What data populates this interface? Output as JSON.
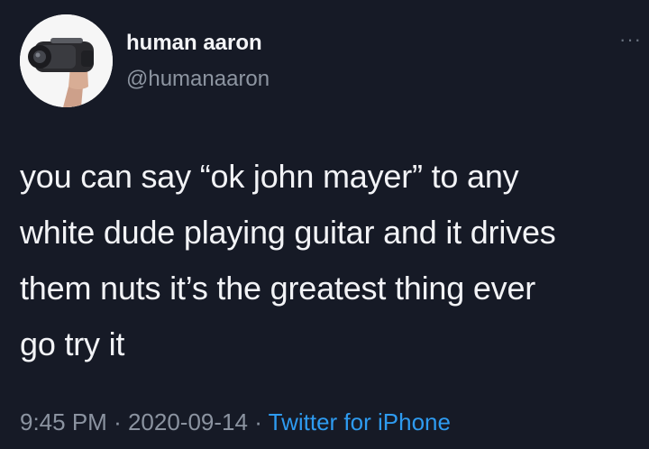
{
  "tweet": {
    "display_name": "human aaron",
    "handle": "@humanaaron",
    "more_icon": "more-horizontal-icon",
    "text_lines": [
      "you can say “ok john mayer” to any",
      "white dude playing guitar and it drives",
      "them nuts it’s the greatest thing ever",
      "go try it"
    ],
    "time": "9:45 PM",
    "date": "2020-09-14",
    "source": "Twitter for iPhone",
    "separator": "·"
  },
  "colors": {
    "background": "#161a26",
    "text": "#f2f3f6",
    "muted": "#8b93a0",
    "link": "#2e9bf0"
  }
}
